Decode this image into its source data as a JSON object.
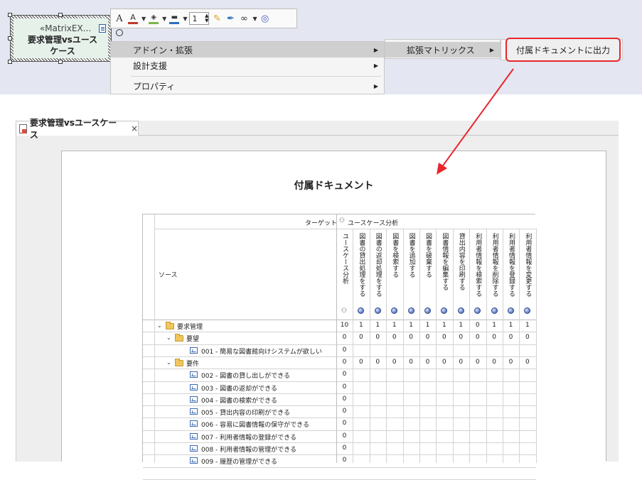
{
  "diagram_element": {
    "stereotype": "«MatrixEX...",
    "name_line1": "要求管理vsユース",
    "name_line2": "ケース"
  },
  "toolbar": {
    "font_button": "A",
    "font_color_glyph": "A",
    "line_width_value": "1",
    "colors": {
      "font": "#c0392b",
      "fill": "#7ab648",
      "line": "#2c6fbd"
    }
  },
  "context_menu": {
    "items": [
      {
        "label": "アドイン・拡張"
      },
      {
        "label": "設計支援"
      },
      {
        "label": "プロパティ"
      }
    ]
  },
  "submenu": {
    "label": "拡張マトリックス"
  },
  "submenu2": {
    "label": "付属ドキュメントに出力"
  },
  "document_tab": {
    "title": "要求管理vsユースケース",
    "close": "×"
  },
  "document": {
    "title": "付属ドキュメント",
    "matrix": {
      "target_label": "ターゲット",
      "target_package": "ユースケース分析",
      "source_label": "ソース",
      "columns": [
        "ユースケース分析",
        "図書の貸出処理をする",
        "図書の返却処理をする",
        "図書を検索する",
        "図書を追加する",
        "図書を破棄する",
        "図書情報を編集する",
        "貸出内容を印刷する",
        "利用者情報を検索する",
        "利用者情報を削除する",
        "利用者情報を登録する",
        "利用者情報を変更する"
      ],
      "rows": [
        {
          "label": "要求管理",
          "kind": "folder",
          "level": 0,
          "values": [
            "10",
            "1",
            "1",
            "1",
            "1",
            "1",
            "1",
            "1",
            "0",
            "1",
            "1",
            "1"
          ]
        },
        {
          "label": "要望",
          "kind": "folder",
          "level": 1,
          "values": [
            "0",
            "0",
            "0",
            "0",
            "0",
            "0",
            "0",
            "0",
            "0",
            "0",
            "0",
            "0"
          ]
        },
        {
          "label": "001 - 簡易な図書館向けシステムが欲しい",
          "kind": "req",
          "level": 2,
          "values": [
            "0"
          ]
        },
        {
          "label": "要件",
          "kind": "folder",
          "level": 1,
          "values": [
            "0",
            "0",
            "0",
            "0",
            "0",
            "0",
            "0",
            "0",
            "0",
            "0",
            "0",
            "0"
          ]
        },
        {
          "label": "002 - 図書の貸し出しができる",
          "kind": "req",
          "level": 2,
          "values": [
            "0"
          ]
        },
        {
          "label": "003 - 図書の返却ができる",
          "kind": "req",
          "level": 2,
          "values": [
            "0"
          ]
        },
        {
          "label": "004 - 図書の検索ができる",
          "kind": "req",
          "level": 2,
          "values": [
            "0"
          ]
        },
        {
          "label": "005 - 貸出内容の印刷ができる",
          "kind": "req",
          "level": 2,
          "values": [
            "0"
          ]
        },
        {
          "label": "006 - 容易に図書情報の保守ができる",
          "kind": "req",
          "level": 2,
          "values": [
            "0"
          ]
        },
        {
          "label": "007 - 利用者情報の登録ができる",
          "kind": "req",
          "level": 2,
          "values": [
            "0"
          ]
        },
        {
          "label": "008 - 利用者情報の管理ができる",
          "kind": "req",
          "level": 2,
          "values": [
            "0"
          ]
        },
        {
          "label": "009 - 履歴の管理ができる",
          "kind": "req",
          "level": 2,
          "values": [
            "0"
          ]
        }
      ]
    }
  },
  "colors": {
    "highlight": "#e8262b",
    "canvas": "#e4e7f1"
  }
}
